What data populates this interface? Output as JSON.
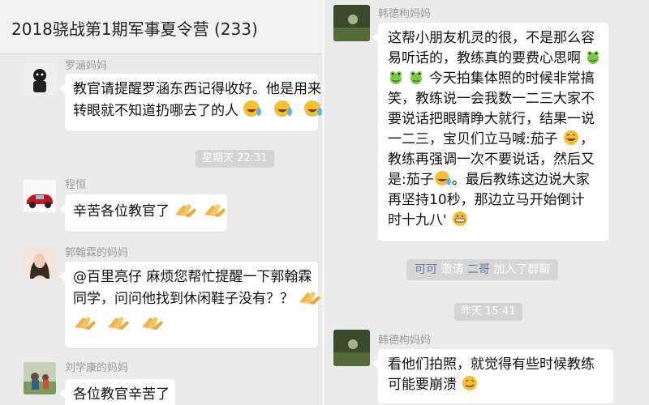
{
  "left": {
    "title": "2018骁战第1期军事夏令营 (233)",
    "messages": [
      {
        "sender": "罗涵妈妈",
        "lines": [
          "教官请提醒罗涵东西记得收好。他是用来",
          "转眼就不知道扔哪去了的人"
        ],
        "emojis": [
          "cry-laugh-emoji",
          "cry-laugh-emoji",
          "cry-laugh-emoji"
        ]
      },
      {
        "time": "星期天 22:31"
      },
      {
        "sender": "程恒",
        "lines": [
          "辛苦各位教官了"
        ],
        "emojis": [
          "clap-hands-emoji",
          "clap-hands-emoji"
        ]
      },
      {
        "sender": "郭翰霖的妈妈",
        "lines": [
          "@百里亮仔 麻烦您帮忙提醒一下郭翰霖",
          "同学，问问他找到休闲鞋子没有？？"
        ],
        "emojis": [
          "clap-hands-emoji",
          "clap-hands-emoji",
          "clap-hands-emoji",
          "clap-hands-emoji"
        ]
      },
      {
        "sender": "刘学康的妈妈",
        "lines": [
          "各位教官辛苦了"
        ]
      }
    ]
  },
  "right": {
    "messages": [
      {
        "sender": "韩德枸妈妈",
        "lines": [
          "这帮小朋友机灵的很，不是那么容",
          "易听话的，教练真的要费心思啊",
          "今天拍集体照的时候非常搞",
          "笑，教练说一会我数一二三大家不",
          "要说话把眼睛睁大就行，结果一说",
          "一二三，宝贝们立马喊:茄子",
          "教练再强调一次不要说话，然后又",
          "是:茄子",
          "。最后教练这边说大家",
          "再坚持10秒，那边立马开始倒计",
          "时十九八'"
        ]
      },
      {
        "system": {
          "name1": "可可",
          "text1": "邀请",
          "name2": "二哥",
          "text2": "加入了群聊"
        }
      },
      {
        "time": "昨天 15:41"
      },
      {
        "sender": "韩德枸妈妈",
        "lines": [
          "看他们拍照，就觉得有些时候教练",
          "可能要崩溃"
        ]
      }
    ]
  },
  "colors": {
    "bubble": "#ffffff",
    "background": "#ebebeb",
    "name_link": "#5b7aa3",
    "emoji_yellow": "#f5c02d",
    "emoji_green": "#7ac943"
  }
}
